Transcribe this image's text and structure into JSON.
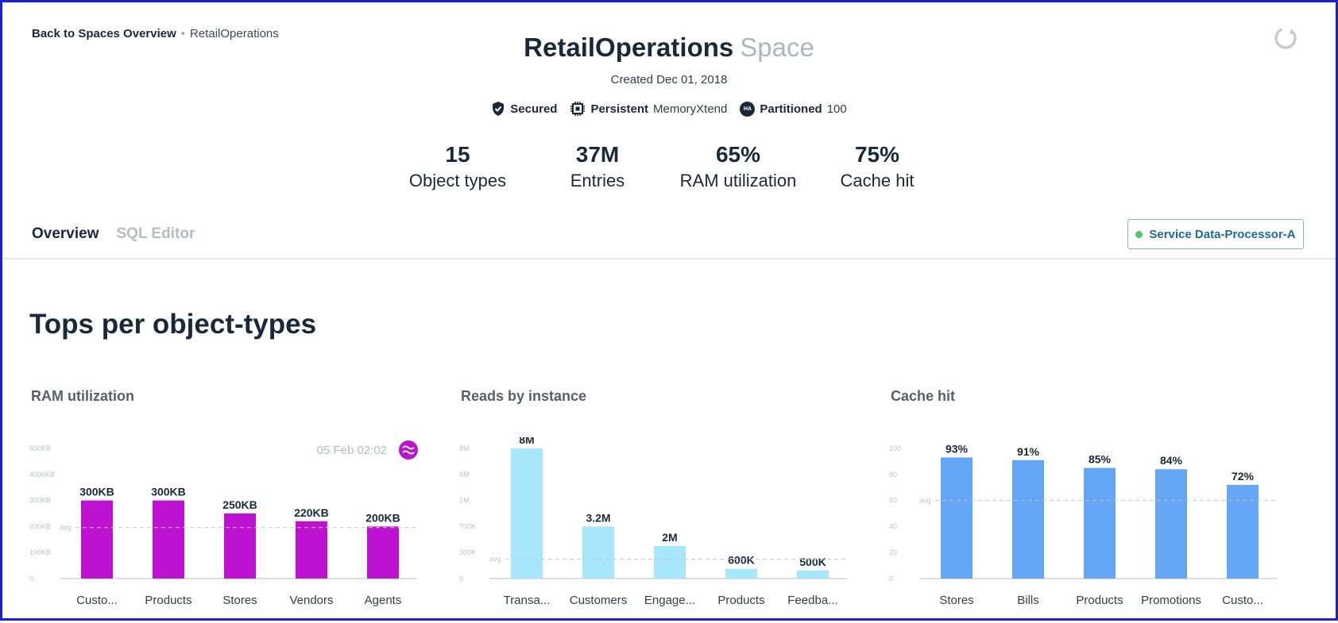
{
  "breadcrumb": {
    "back": "Back to Spaces Overview",
    "separator": "•",
    "current": "RetailOperations"
  },
  "header": {
    "name": "RetailOperations",
    "suffix": "Space",
    "created": "Created Dec 01, 2018"
  },
  "badges": {
    "secured": "Secured",
    "persistent": "Persistent",
    "persistent_value": "MemoryXtend",
    "ha_icon_text": "HA",
    "partitioned": "Partitioned",
    "partitioned_value": "100"
  },
  "stats": [
    {
      "value": "15",
      "label": "Object types"
    },
    {
      "value": "37M",
      "label": "Entries"
    },
    {
      "value": "65%",
      "label": "RAM utilization"
    },
    {
      "value": "75%",
      "label": "Cache hit"
    }
  ],
  "tabs": {
    "overview": "Overview",
    "sql": "SQL Editor"
  },
  "service_button": {
    "label": "Service Data-Processor-A",
    "status_color": "#4cc96b"
  },
  "section": {
    "title": "Tops per object-types"
  },
  "panels": [
    {
      "title": "RAM utilization"
    },
    {
      "title": "Reads by instance"
    },
    {
      "title": "Cache hit"
    }
  ],
  "chart_data": [
    {
      "type": "bar",
      "title": "RAM utilization",
      "color": "#bd13d0",
      "categories": [
        "Custo...",
        "Products",
        "Stores",
        "Vendors",
        "Agents"
      ],
      "values": [
        300,
        300,
        250,
        220,
        200
      ],
      "value_labels": [
        "300KB",
        "300KB",
        "250KB",
        "220KB",
        "200KB"
      ],
      "yticks": [
        "500KB",
        "4000KB",
        "300KB",
        "200KB",
        "100KB",
        "0"
      ],
      "ytick_values": [
        500,
        400,
        300,
        200,
        100,
        0
      ],
      "ylim": [
        0,
        500
      ],
      "avg_label": "avg",
      "avg_value": 196,
      "timestamp": "05 Feb 02:02",
      "trend_icon_color": "#bd13d0"
    },
    {
      "type": "bar",
      "title": "Reads by instance",
      "color": "#a7e7fb",
      "categories": [
        "Transa...",
        "Customers",
        "Engage...",
        "Products",
        "Feedba..."
      ],
      "values": [
        8,
        3.2,
        2,
        0.6,
        0.5
      ],
      "value_labels": [
        "8M",
        "3.2M",
        "2M",
        "600K",
        "500K"
      ],
      "yticks": [
        "8M",
        "4M",
        "1M",
        "700K",
        "300K",
        "0"
      ],
      "ylim": [
        0,
        8
      ],
      "avg_label": "avg"
    },
    {
      "type": "bar",
      "title": "Cache hit",
      "color": "#62a6f5",
      "categories": [
        "Stores",
        "Bills",
        "Products",
        "Promotions",
        "Custo..."
      ],
      "values": [
        93,
        91,
        85,
        84,
        72
      ],
      "value_labels": [
        "93%",
        "91%",
        "85%",
        "84%",
        "72%"
      ],
      "yticks": [
        "100",
        "80",
        "60",
        "40",
        "20",
        "0"
      ],
      "ytick_values": [
        100,
        80,
        60,
        40,
        20,
        0
      ],
      "ylim": [
        0,
        100
      ],
      "avg_label": "avg",
      "avg_value": 60
    }
  ]
}
